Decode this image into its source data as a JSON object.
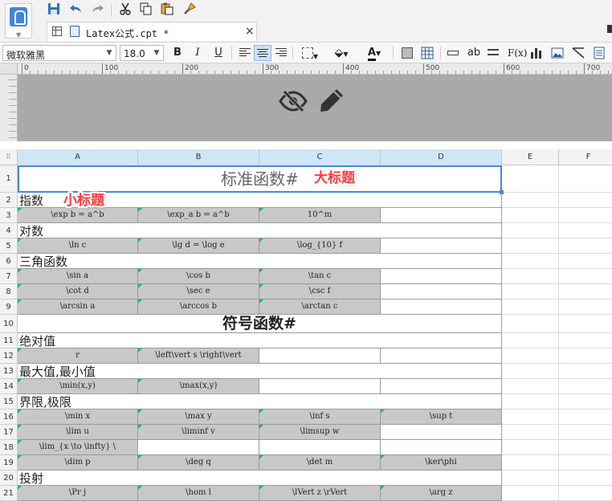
{
  "quick_toolbar": {
    "buttons": [
      "save",
      "undo",
      "redo",
      "cut",
      "copy",
      "paste",
      "format-painter"
    ]
  },
  "tab": {
    "title": "Latex公式.cpt *",
    "close": "×"
  },
  "format": {
    "font": "微软雅黑",
    "size": "18.0",
    "bold": "B",
    "italic": "I",
    "underline": "U",
    "text_color_letter": "A",
    "abc": "ab",
    "fx": "F(x)"
  },
  "ruler": {
    "labels": [
      "0",
      "100",
      "200",
      "300",
      "400",
      "500",
      "600",
      "700"
    ]
  },
  "columns": [
    "A",
    "B",
    "C",
    "D",
    "E",
    "F"
  ],
  "rows": [
    "1",
    "2",
    "3",
    "4",
    "5",
    "6",
    "7",
    "8",
    "9",
    "10",
    "11",
    "12",
    "13",
    "14",
    "15",
    "16",
    "17",
    "18",
    "19",
    "20",
    "21"
  ],
  "sheet": {
    "title": "标准函数#",
    "title_tag": "大标题",
    "section_tag": "小标题",
    "sym_title": "符号函数#",
    "sections": {
      "r2": "指数",
      "r4": "对数",
      "r6": "三角函数",
      "r11": "绝对值",
      "r13": "最大值,最小值",
      "r15": "界限,极限",
      "r20": "投射"
    },
    "r3": [
      "\\exp b = a^b",
      "\\exp_a b = a^b",
      "10^m"
    ],
    "r5": [
      "\\ln c",
      "\\lg d = \\log e",
      "\\log_{10} f"
    ],
    "r7": [
      "\\sin a",
      "\\cos b",
      "\\tan c"
    ],
    "r8": [
      "\\cot d",
      "\\sec e",
      "\\csc f"
    ],
    "r9": [
      "\\arcsin a",
      "\\arccos b",
      "\\arctan c"
    ],
    "r12": [
      "r",
      "\\left\\vert s \\right\\vert"
    ],
    "r14": [
      "\\min(x,y)",
      "\\max(x,y)"
    ],
    "r16": [
      "\\min x",
      "\\max y",
      "\\inf s",
      "\\sup t"
    ],
    "r17": [
      "\\lim u",
      "\\liminf v",
      "\\limsup w"
    ],
    "r18": [
      "\\lim_{x \\to \\infty} \\"
    ],
    "r19": [
      "\\dim p",
      "\\deg q",
      "\\det m",
      "\\ker\\phi"
    ],
    "r21": [
      "\\Pr j",
      "\\hom l",
      "\\lVert z \\rVert",
      "\\arg z"
    ]
  }
}
